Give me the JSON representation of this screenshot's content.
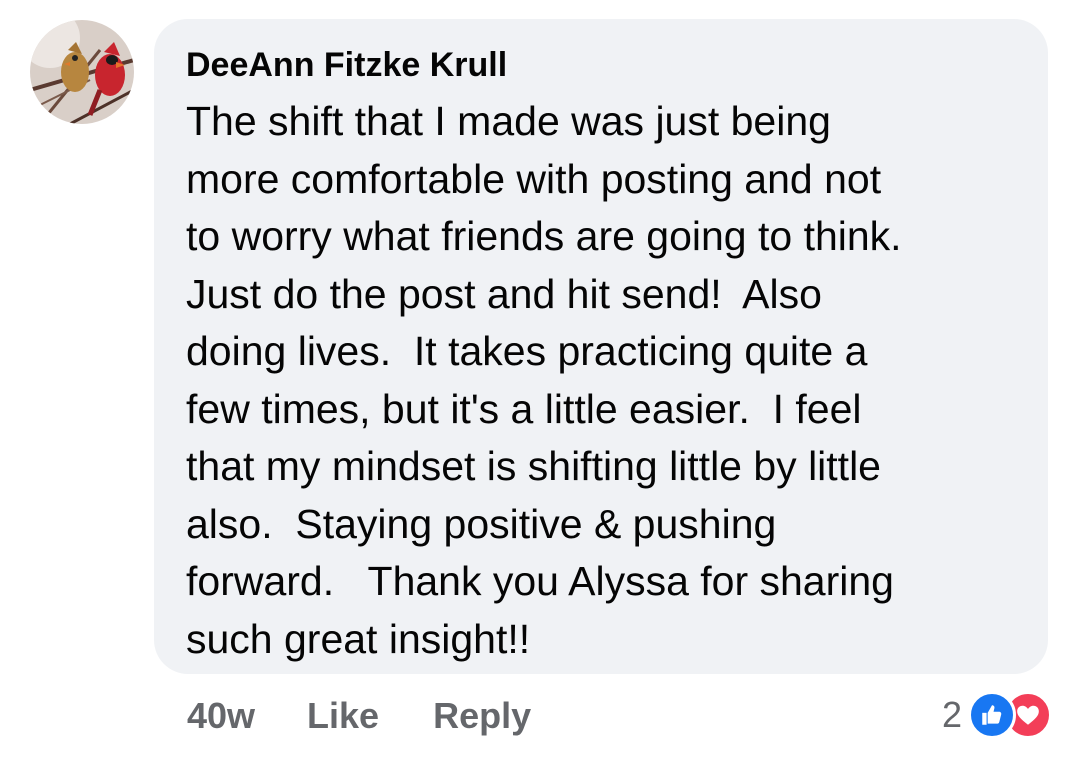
{
  "comment": {
    "author": "DeeAnn Fitzke Krull",
    "text_lines": [
      "The shift that I made was just being",
      "more comfortable with posting and not",
      "to worry what friends are going to think.",
      "Just do the post and hit send!  Also",
      "doing lives.  It takes practicing quite a",
      "few times, but it's a little easier.  I feel",
      "that my mindset is shifting little by little",
      "also.  Staying positive & pushing",
      "forward.   Thank you Alyssa for sharing",
      "such great insight!!"
    ]
  },
  "actions": {
    "age": "40w",
    "like_label": "Like",
    "reply_label": "Reply"
  },
  "reactions": {
    "count": "2",
    "icons": [
      "like-icon",
      "love-icon"
    ],
    "like_color": "#1877f2",
    "love_color": "#f33e58"
  },
  "colors": {
    "bubble_bg": "#f0f2f5",
    "text": "#050505",
    "secondary_text": "#65676b"
  }
}
